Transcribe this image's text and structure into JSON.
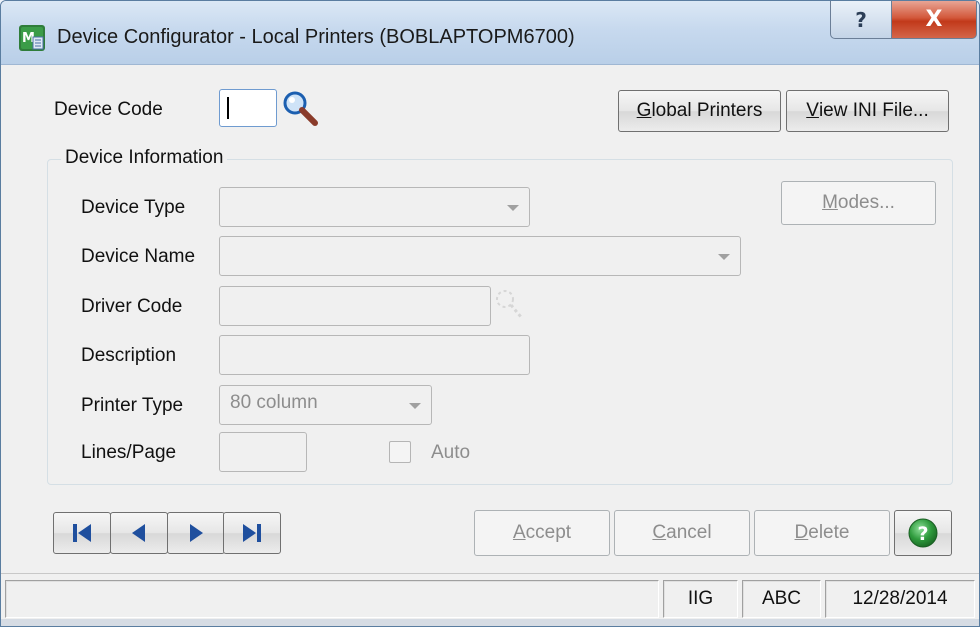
{
  "window": {
    "title": "Device Configurator - Local Printers (BOBLAPTOPM6700)",
    "help_glyph": "?",
    "close_glyph": "X"
  },
  "device_code": {
    "label": "Device Code",
    "value": ""
  },
  "top_buttons": {
    "global_printers_mnemonic": "G",
    "global_printers_rest": "lobal Printers",
    "view_ini_mnemonic": "V",
    "view_ini_rest": "iew INI File..."
  },
  "device_info": {
    "group_title": "Device Information",
    "device_type_label": "Device Type",
    "device_type_value": "",
    "device_name_label": "Device Name",
    "device_name_value": "",
    "driver_code_label": "Driver Code",
    "driver_code_value": "",
    "description_label": "Description",
    "description_value": "",
    "printer_type_label": "Printer Type",
    "printer_type_value": "80 column",
    "lines_page_label": "Lines/Page",
    "lines_page_value": "",
    "auto_label": "Auto",
    "auto_checked": false,
    "modes_mnemonic": "M",
    "modes_rest": "odes..."
  },
  "actions": {
    "accept_mnemonic": "A",
    "accept_rest": "ccept",
    "cancel_mnemonic": "C",
    "cancel_rest": "ancel",
    "delete_mnemonic": "D",
    "delete_rest": "elete"
  },
  "statusbar": {
    "message": "",
    "company": "IIG",
    "company_name": "ABC",
    "date": "12/28/2014"
  },
  "colors": {
    "nav_arrow": "#1f4f9e",
    "help_green": "#2e9a3c",
    "lookup_lens": "#1c5fb0"
  },
  "icons": [
    "app-icon",
    "search-icon",
    "lookup-icon",
    "first-record-icon",
    "previous-record-icon",
    "next-record-icon",
    "last-record-icon",
    "help-icon"
  ]
}
